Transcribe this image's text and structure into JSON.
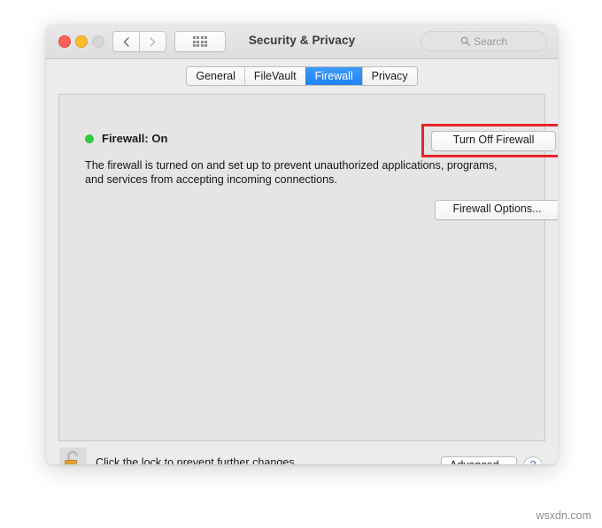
{
  "window": {
    "title": "Security & Privacy",
    "traffic_lights": [
      {
        "name": "close",
        "color": "#ff5f57"
      },
      {
        "name": "minimize",
        "color": "#ffbd2e"
      },
      {
        "name": "zoom",
        "color": "#d6d6d6"
      }
    ],
    "nav": {
      "back_icon": "chevron-left-icon",
      "forward_icon": "chevron-right-icon",
      "show_all_icon": "grid-icon"
    }
  },
  "search": {
    "icon": "search-icon",
    "placeholder": "Search",
    "value": ""
  },
  "tabs": [
    {
      "label": "General",
      "selected": false
    },
    {
      "label": "FileVault",
      "selected": false
    },
    {
      "label": "Firewall",
      "selected": true
    },
    {
      "label": "Privacy",
      "selected": false
    }
  ],
  "firewall": {
    "status_label": "Firewall: On",
    "status_color": "#2ecc40",
    "status_dot_icon": "status-dot-icon",
    "description": "The firewall is turned on and set up to prevent unauthorized applications, programs, and services from accepting incoming connections.",
    "turn_off_button": "Turn Off Firewall",
    "options_button": "Firewall Options...",
    "highlight_color": "#e8242a"
  },
  "footer": {
    "lock_icon": "unlocked-padlock-icon",
    "lock_text": "Click the lock to prevent further changes.",
    "advanced_button": "Advanced...",
    "help_button": "?"
  },
  "watermark": "wsxdn.com"
}
